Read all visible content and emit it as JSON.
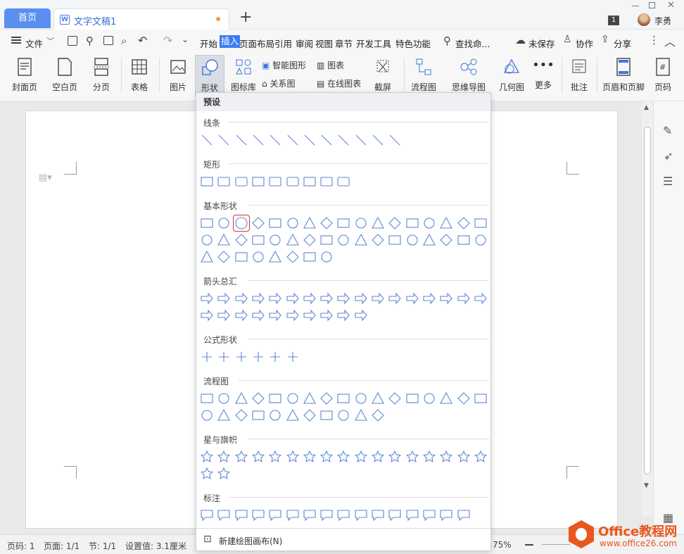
{
  "topbar": {
    "home_tab": "首页",
    "doc_tab": "文字文稿1",
    "doc_icon": "W",
    "count_badge": "1",
    "user_name": "李勇"
  },
  "menu": {
    "file": "文件",
    "tabs": [
      "开始",
      "插入",
      "页面布局",
      "引用",
      "审阅",
      "视图",
      "章节",
      "开发工具",
      "特色功能"
    ],
    "active_tab": "插入",
    "search": "查找命...",
    "unsaved": "未保存",
    "collab": "协作",
    "share": "分享"
  },
  "ribbon": {
    "cover": "封面页",
    "blank": "空白页",
    "pagebreak": "分页",
    "table": "表格",
    "image": "图片",
    "shape": "形状",
    "iconlib": "图标库",
    "smartart": "智能图形",
    "chart": "图表",
    "relation": "关系图",
    "onlinechart": "在线图表",
    "screenshot": "截屏",
    "flowchart": "流程图",
    "mindmap": "思维导图",
    "geometry": "几何图",
    "more": "更多",
    "comment": "批注",
    "header_footer": "页眉和页脚",
    "page_number": "页码"
  },
  "shapes_panel": {
    "preset": "预设",
    "sections": [
      {
        "label": "线条",
        "count": 12
      },
      {
        "label": "矩形",
        "count": 9
      },
      {
        "label": "基本形状",
        "count": 42
      },
      {
        "label": "箭头总汇",
        "count": 27
      },
      {
        "label": "公式形状",
        "count": 6
      },
      {
        "label": "流程图",
        "count": 28
      },
      {
        "label": "星与旗帜",
        "count": 19
      },
      {
        "label": "标注",
        "count": 16
      }
    ],
    "selected_shape": "oval",
    "new_canvas": "新建绘图画布(N)"
  },
  "status": {
    "page": "页码: 1",
    "pages": "页面: 1/1",
    "section": "节: 1/1",
    "setting": "设置值: 3.1厘米",
    "zoom": "75%"
  },
  "watermark": {
    "brand": "Office教程网",
    "url": "www.office26.com"
  }
}
